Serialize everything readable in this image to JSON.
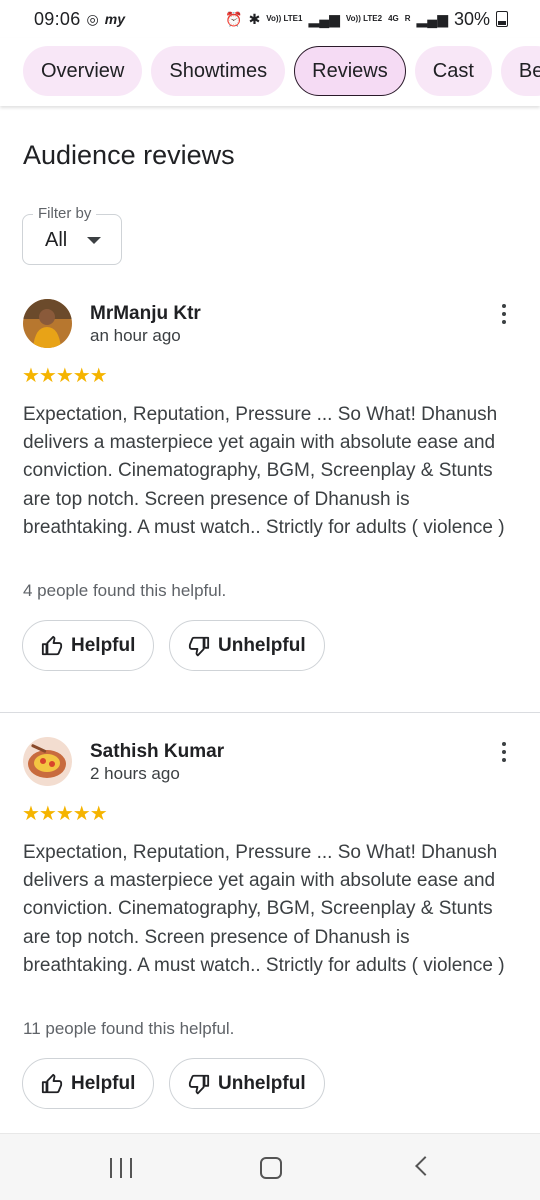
{
  "status_bar": {
    "time": "09:06",
    "battery": "30%",
    "network_labels": [
      "Vo)) LTE1",
      "Vo)) LTE2",
      "4G",
      "R"
    ]
  },
  "tabs": [
    {
      "label": "Overview",
      "active": false
    },
    {
      "label": "Showtimes",
      "active": false
    },
    {
      "label": "Reviews",
      "active": true
    },
    {
      "label": "Cast",
      "active": false
    },
    {
      "label": "Be",
      "active": false
    }
  ],
  "page": {
    "heading": "Audience reviews",
    "filter": {
      "label": "Filter by",
      "value": "All"
    }
  },
  "reviews": [
    {
      "name": "MrManju Ktr",
      "time": "an hour ago",
      "stars": "★★★★★",
      "rating": 5,
      "text": "Expectation, Reputation, Pressure ... So What! Dhanush delivers a masterpiece yet again with absolute ease and conviction. Cinematography, BGM, Screenplay & Stunts are top notch. Screen presence of Dhanush is breathtaking. A must watch.. Strictly for adults ( violence )",
      "helpful_count": "4 people found this helpful.",
      "helpful_label": "Helpful",
      "unhelpful_label": "Unhelpful"
    },
    {
      "name": "Sathish Kumar",
      "time": "2 hours ago",
      "stars": "★★★★★",
      "rating": 5,
      "text": "Expectation, Reputation, Pressure ... So What! Dhanush delivers a masterpiece yet again with absolute ease and conviction. Cinematography, BGM, Screenplay & Stunts are top notch. Screen presence of Dhanush is breathtaking. A must watch.. Strictly for adults ( violence )",
      "helpful_count": "11 people found this helpful.",
      "helpful_label": "Helpful",
      "unhelpful_label": "Unhelpful"
    }
  ],
  "colors": {
    "tab_bg": "#f8e7f7",
    "star": "#f5b400",
    "text": "#3c4043"
  }
}
